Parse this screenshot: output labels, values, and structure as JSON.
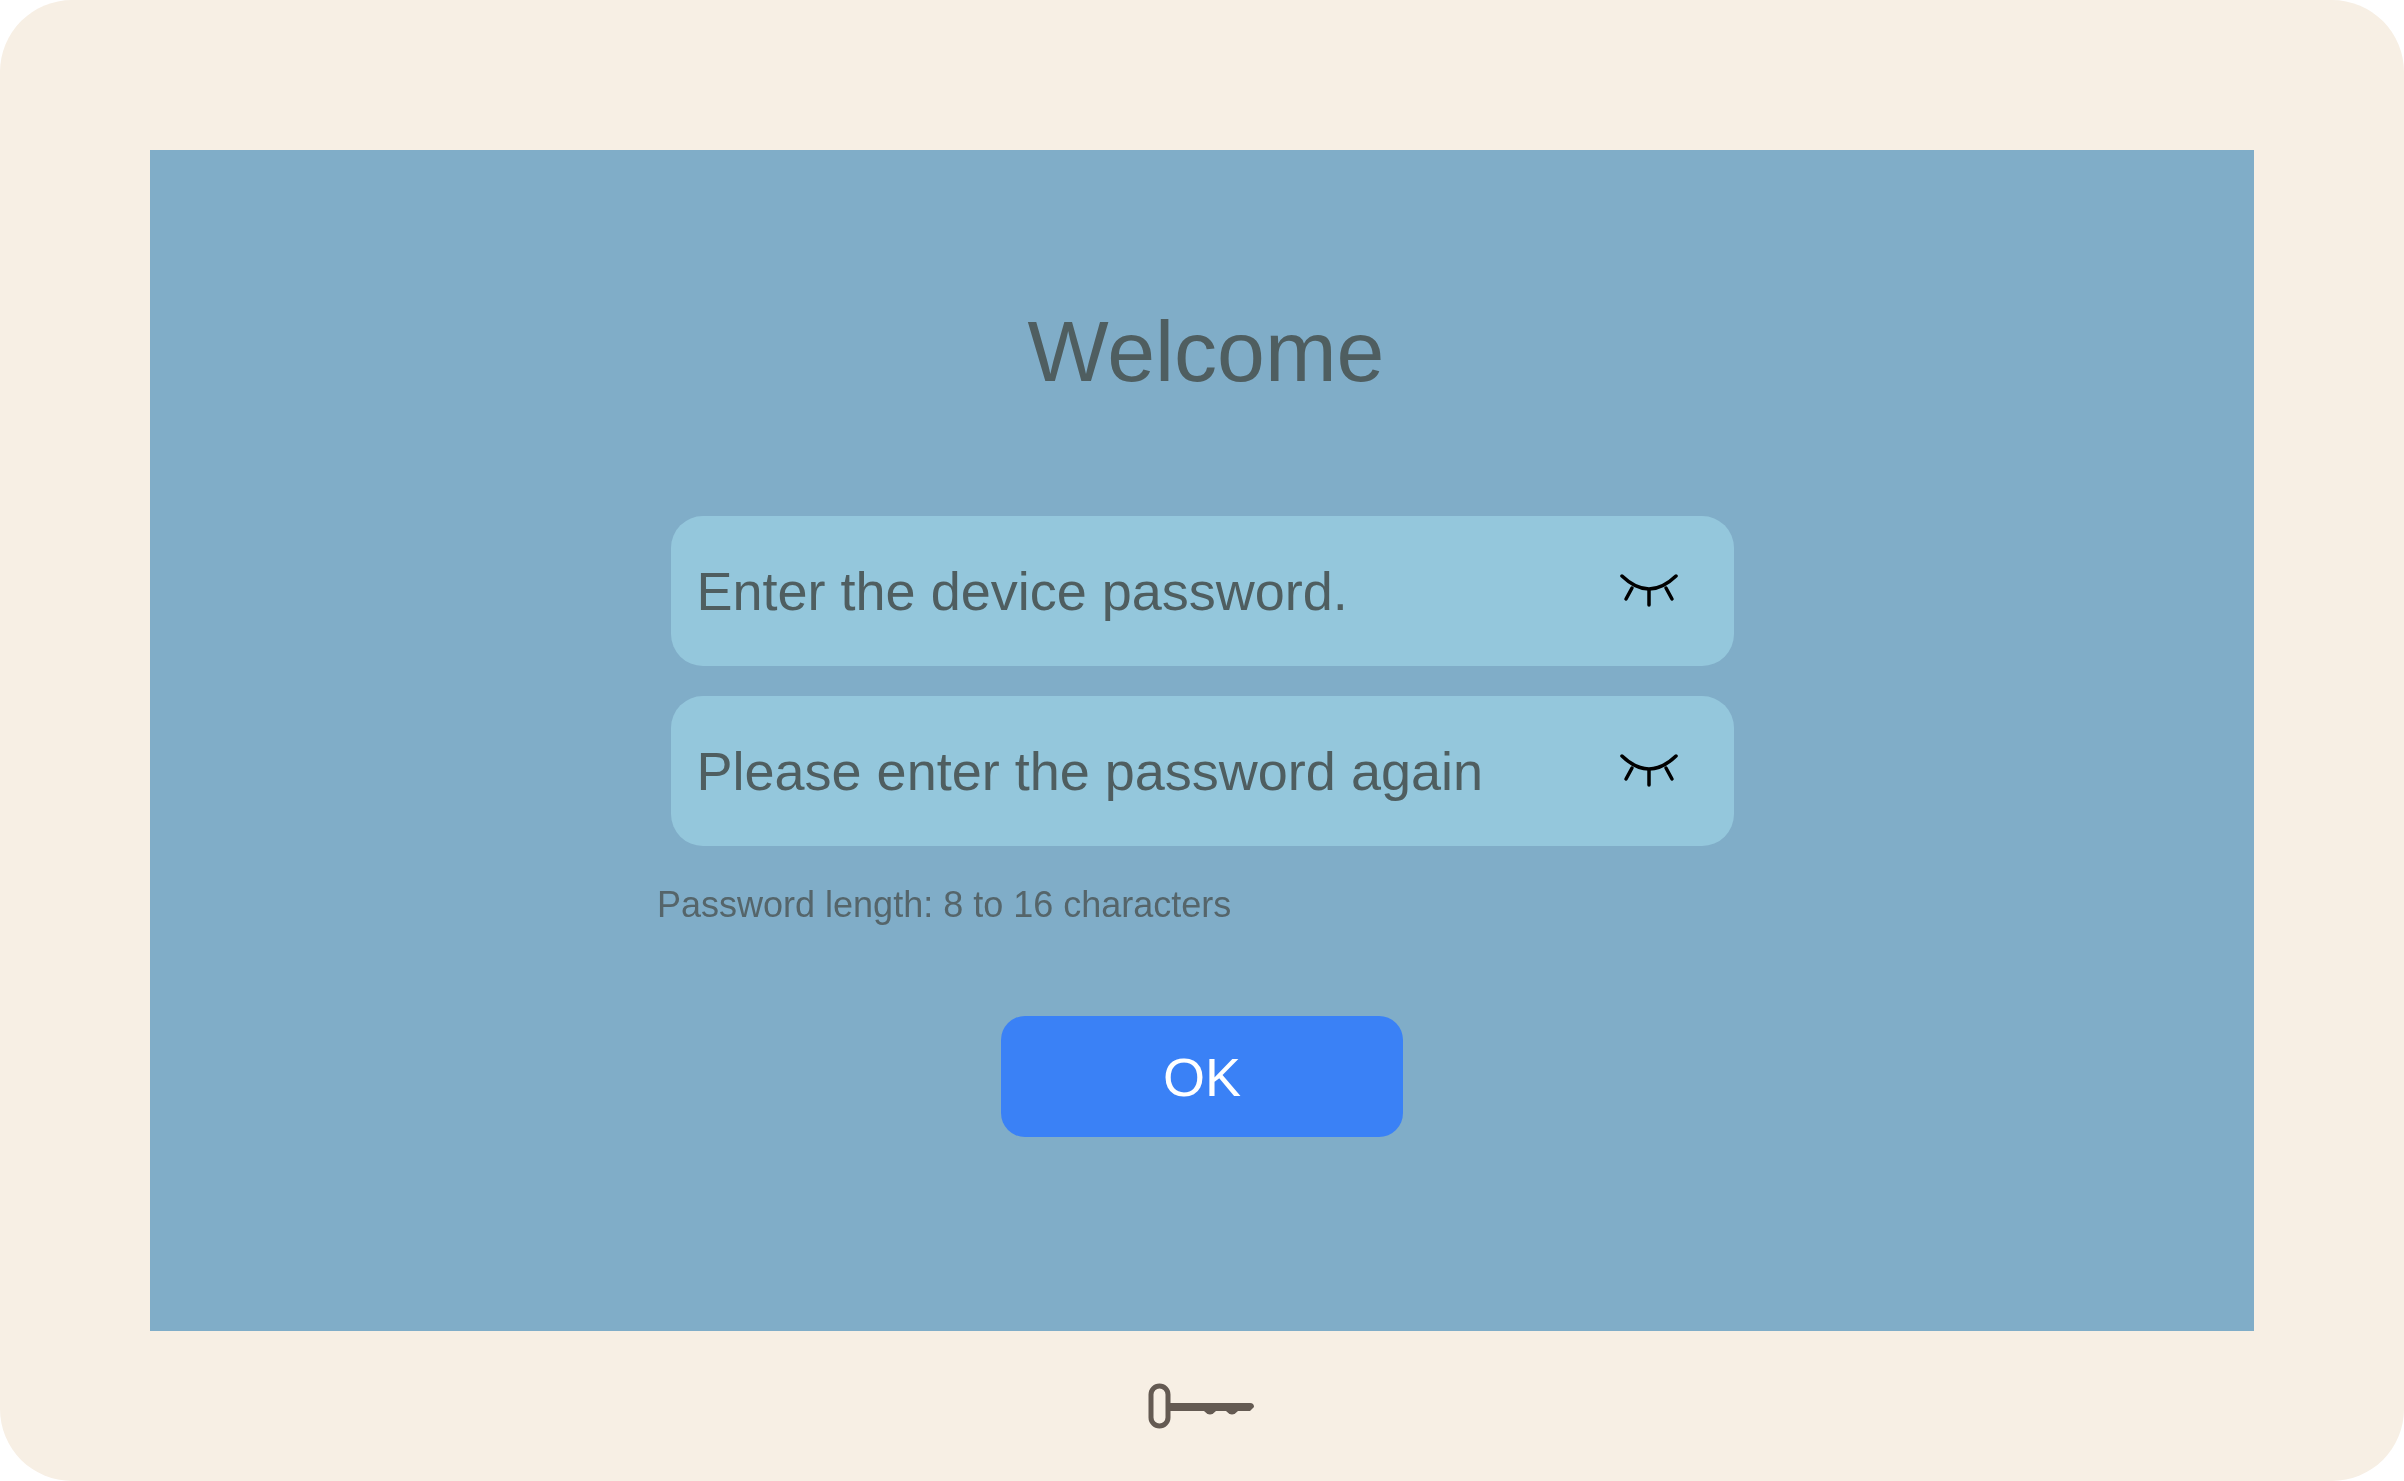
{
  "title": "Welcome",
  "fields": [
    {
      "placeholder": "Enter the device password.",
      "visible": false
    },
    {
      "placeholder": "Please enter the password again",
      "visible": false
    }
  ],
  "hint": "Password length: 8 to 16 characters",
  "button": "OK"
}
